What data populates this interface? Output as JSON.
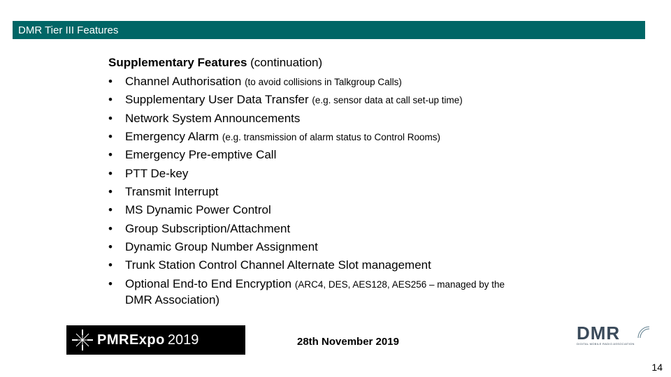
{
  "header": {
    "title": "DMR Tier III Features"
  },
  "heading": {
    "bold": "Supplementary Features",
    "rest": " (continuation)"
  },
  "bullets": [
    {
      "main": "Channel Authorisation ",
      "note": "(to avoid collisions in Talkgroup Calls)"
    },
    {
      "main": "Supplementary User Data Transfer ",
      "note": "(e.g. sensor data at call set-up time)"
    },
    {
      "main": "Network System Announcements",
      "note": ""
    },
    {
      "main": "Emergency Alarm ",
      "note": "(e.g. transmission of alarm status to Control Rooms)"
    },
    {
      "main": "Emergency Pre-emptive Call",
      "note": ""
    },
    {
      "main": "PTT De-key",
      "note": ""
    },
    {
      "main": "Transmit Interrupt",
      "note": ""
    },
    {
      "main": "MS Dynamic Power Control",
      "note": ""
    },
    {
      "main": "Group Subscription/Attachment",
      "note": ""
    },
    {
      "main": "Dynamic Group Number Assignment",
      "note": ""
    },
    {
      "main": "Trunk Station Control Channel Alternate Slot management",
      "note": ""
    },
    {
      "main": "Optional End-to End Encryption ",
      "note": "(ARC4, DES, AES128, AES256 – managed by the"
    }
  ],
  "trail": "DMR Association)",
  "footer": {
    "pmr_label_bold": "PMRExpo",
    "pmr_label_year": "2019",
    "date": "28th November 2019",
    "dmr_big": "DMR",
    "dmr_small": "DIGITAL MOBILE RADIO ASSOCIATION"
  },
  "page": "14"
}
